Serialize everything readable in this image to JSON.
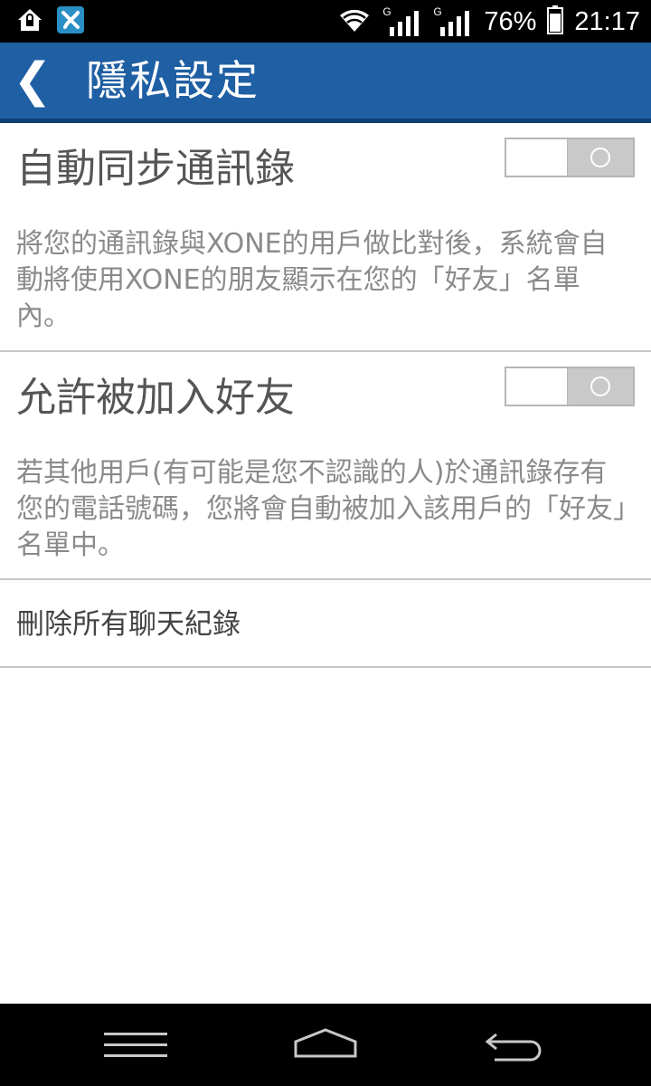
{
  "status_bar": {
    "battery": "76%",
    "time": "21:17",
    "network_type_1": "G",
    "network_type_2": "G",
    "icons": [
      "home-lock-icon",
      "app-notification-icon",
      "wifi-icon",
      "signal-icon",
      "signal-icon",
      "battery-icon"
    ]
  },
  "action_bar": {
    "back_icon": "chevron-left-icon",
    "back_glyph": "❮",
    "title": "隱私設定",
    "colors": {
      "background": "#1f5fa3",
      "underline": "#0f3f73"
    }
  },
  "settings": [
    {
      "title": "自動同步通訊錄",
      "description": "將您的通訊錄與XONE的用戶做比對後，系統會自動將使用XONE的朋友顯示在您的「好友」名單內。",
      "toggle": "off"
    },
    {
      "title": "允許被加入好友",
      "description": "若其他用戶(有可能是您不認識的人)於通訊錄存有您的電話號碼，您將會自動被加入該用戶的「好友」名單中。",
      "toggle": "off"
    }
  ],
  "actions": {
    "delete_chat_history": "刪除所有聊天紀錄"
  },
  "nav_bar": {
    "icons": [
      "menu-icon",
      "home-icon",
      "back-icon"
    ]
  }
}
